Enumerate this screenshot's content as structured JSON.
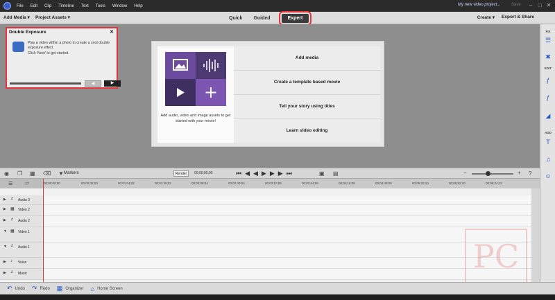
{
  "titlebar": {
    "menu": [
      "File",
      "Edit",
      "Clip",
      "Timeline",
      "Text",
      "Tools",
      "Window",
      "Help"
    ],
    "doc_title": "My new video project...",
    "save": "Save"
  },
  "toolbar": {
    "add_media": "Add Media ▾",
    "project_assets": "Project Assets ▾",
    "modes": [
      "Quick",
      "Guided",
      "Expert"
    ],
    "active_mode": "Expert",
    "create": "Create ▾",
    "export_share": "Export & Share"
  },
  "right_panel": {
    "fix": "FIX",
    "edit": "EDIT",
    "add": "ADD"
  },
  "welcome": {
    "caption": "Add audio, video and image assets to get started with your movie!",
    "options": [
      "Add media",
      "Create a template based movie",
      "Tell your story using titles",
      "Learn video editing"
    ]
  },
  "popup": {
    "title": "Double Exposure",
    "text": "Play a video within a photo to create a cool double exposure effect.",
    "text2": "Click 'Next' to get started."
  },
  "timeline": {
    "markers": "Markers",
    "render": "Render",
    "timecode": "00;00;00;00",
    "ruler": [
      "00;00;00;00",
      "00;00;32;00",
      "00;01;04;02",
      "00;01;36;02",
      "00;02;08;04",
      "00;02;40;04",
      "00;03;12;06",
      "00;03;44;06",
      "00;04;16;08",
      "00;04;48;08",
      "00;05;20;10",
      "00;05;52;10",
      "00;06;24;12"
    ],
    "tracks": [
      "Audio 3",
      "Video 2",
      "Audio 2",
      "Video 1",
      "Audio 1",
      "Voice",
      "Music"
    ]
  },
  "bottombar": {
    "undo": "Undo",
    "redo": "Redo",
    "organizer": "Organizer",
    "home": "Home Screen"
  }
}
